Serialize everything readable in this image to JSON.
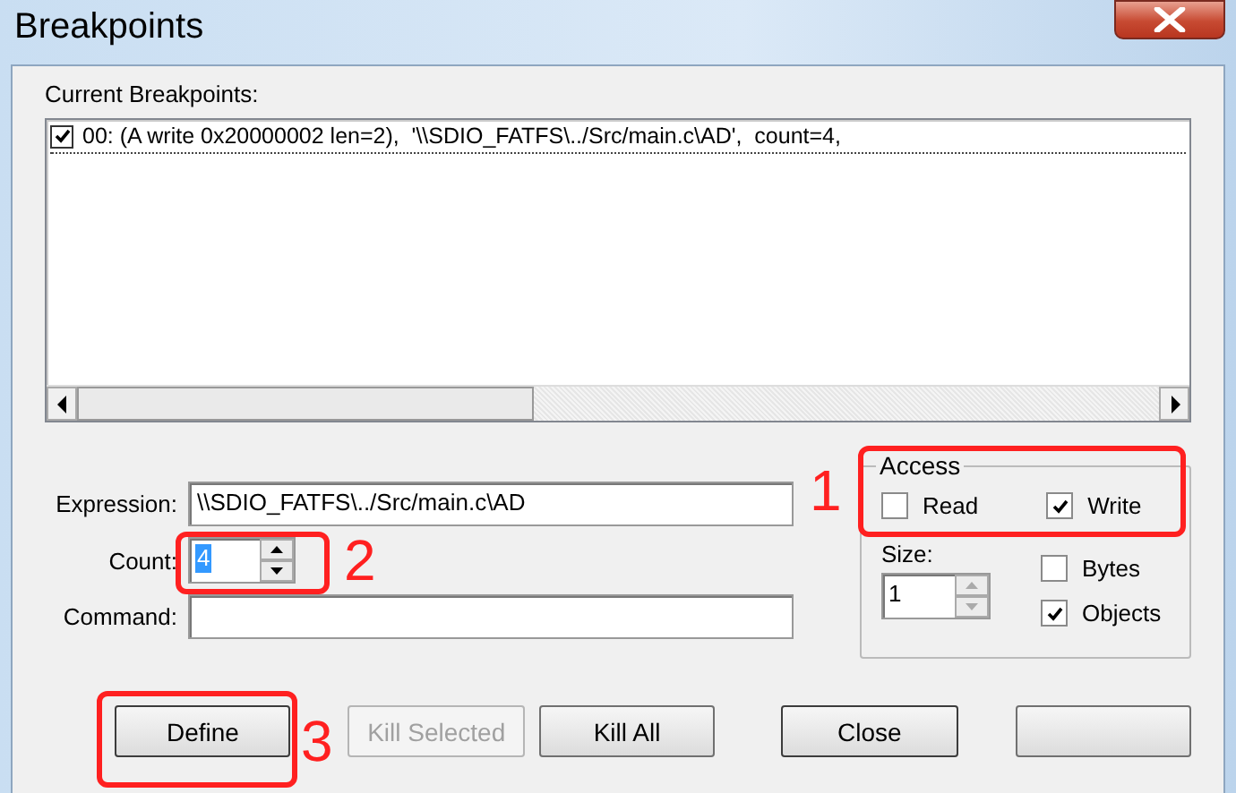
{
  "window": {
    "title": "Breakpoints"
  },
  "current_breakpoints": {
    "label": "Current Breakpoints:",
    "items": [
      {
        "text": "00: (A write 0x20000002 len=2),  '\\\\SDIO_FATFS\\../Src/main.c\\AD',  count=4,",
        "checked": true
      }
    ]
  },
  "expression": {
    "label": "Expression:",
    "value": "\\\\SDIO_FATFS\\../Src/main.c\\AD"
  },
  "count": {
    "label": "Count:",
    "value": "4"
  },
  "command": {
    "label": "Command:"
  },
  "access": {
    "title": "Access",
    "options": [
      {
        "label": "Read",
        "checked": false
      },
      {
        "label": "Write",
        "checked": true
      }
    ]
  },
  "size": {
    "label": "Size:",
    "value": "1"
  },
  "units": [
    {
      "label": "Bytes",
      "checked": false
    },
    {
      "label": "Objects",
      "checked": true
    }
  ],
  "buttons": [
    {
      "label": "Define",
      "disabled": false
    },
    {
      "label": "Kill Selected",
      "disabled": true
    },
    {
      "label": "Kill All",
      "disabled": false
    },
    {
      "label": "Close",
      "disabled": false
    },
    {
      "disabled": false
    }
  ],
  "annotations": [
    {
      "label": "1"
    },
    {
      "label": "2"
    },
    {
      "label": "3"
    }
  ]
}
